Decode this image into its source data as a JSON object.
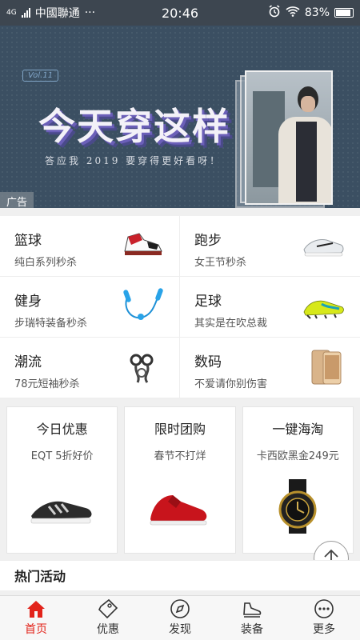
{
  "status_bar": {
    "carrier": "中國聯通",
    "network": "4G",
    "more": "···",
    "time": "20:46",
    "battery": "83%"
  },
  "banner": {
    "vol": "Vol.11",
    "headline": "今天穿这样",
    "subline": "答应我 2019 要穿得更好看呀！",
    "ad_tag": "广告",
    "active_dot": 1,
    "dot_count": 4
  },
  "categories": [
    {
      "title": "篮球",
      "desc": "纯白系列秒杀",
      "icon": "basketball-shoe-icon"
    },
    {
      "title": "跑步",
      "desc": "女王节秒杀",
      "icon": "running-shoe-icon"
    },
    {
      "title": "健身",
      "desc": "步瑞特装备秒杀",
      "icon": "jump-rope-icon"
    },
    {
      "title": "足球",
      "desc": "其实是在吹总裁",
      "icon": "football-boot-icon"
    },
    {
      "title": "潮流",
      "desc": "78元短袖秒杀",
      "icon": "accessory-icon"
    },
    {
      "title": "数码",
      "desc": "不爱请你别伤害",
      "icon": "phone-icon"
    }
  ],
  "deals": [
    {
      "title": "今日优惠",
      "desc": "EQT 5折好价",
      "icon": "sneaker-icon"
    },
    {
      "title": "限时团购",
      "desc": "春节不打烊",
      "icon": "red-basketball-shoe-icon"
    },
    {
      "title": "一键海淘",
      "desc": "卡西欧黑金249元",
      "icon": "watch-icon"
    }
  ],
  "hot_section": {
    "title": "热门活动"
  },
  "tabbar": [
    {
      "label": "首页",
      "icon": "home-icon",
      "active": true
    },
    {
      "label": "优惠",
      "icon": "coupon-icon",
      "active": false
    },
    {
      "label": "发现",
      "icon": "compass-icon",
      "active": false
    },
    {
      "label": "装备",
      "icon": "shoe-icon",
      "active": false
    },
    {
      "label": "更多",
      "icon": "more-icon",
      "active": false
    }
  ],
  "colors": {
    "accent": "#e2231a",
    "status_bar": "#3d4650",
    "banner_bg": "#3b4f62"
  }
}
